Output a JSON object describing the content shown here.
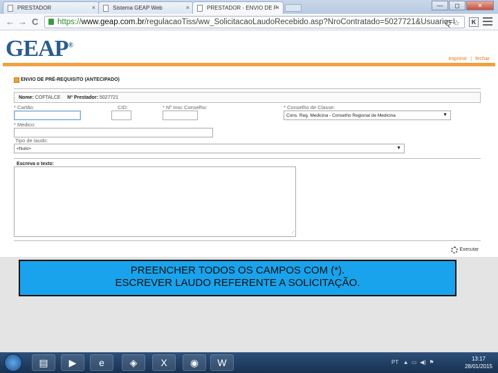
{
  "browser": {
    "tabs": [
      {
        "label": "PRESTADOR",
        "close": "×"
      },
      {
        "label": "Sistema GEAP Web",
        "close": "×"
      },
      {
        "label": "PRESTADOR - ENVIO DE P",
        "close": "×"
      }
    ],
    "window_controls": {
      "minimize": "—",
      "maximize": "◻",
      "close": "✕"
    },
    "nav": {
      "back": "←",
      "forward": "→",
      "reload": "C"
    },
    "url": {
      "scheme": "https://",
      "host": "www.geap.com.br",
      "path": "/regulacaoTiss/ww_SolicitacaoLaudoRecebido.asp?NroContratado=5027721&Usuario=I"
    },
    "url_icons": "Q ☆",
    "ext_button": "K"
  },
  "header": {
    "logo": "GEAP",
    "logo_mark": "®",
    "links": {
      "print": "imprimir",
      "separator": "|",
      "close": "fechar"
    }
  },
  "form": {
    "title": "ENVIO DE PRÉ-REQUISITO (ANTECIPADO)",
    "info": {
      "name_label": "Nome:",
      "name_value": "COFTALCE",
      "provider_label": "Nº Prestador:",
      "provider_value": "5027721"
    },
    "fields": {
      "cartao_label": "* Cartão:",
      "cid_label": "CID:",
      "conselho_num_label": "* Nº Insc Conselho:",
      "conselho_classe_label": "* Conselho de Classe:",
      "conselho_classe_value": "Cons. Reg. Medicina - Conselho Regional de Medicina",
      "medico_label": "* Medico:",
      "tipo_laudo_label": "Tipo de laudo:",
      "tipo_laudo_value": "<Nulo>",
      "texto_label": "Escreva o texto:"
    },
    "execute_label": "Executar"
  },
  "annotation": {
    "line1": "PREENCHER TODOS OS CAMPOS COM  (*).",
    "line2": "ESCREVER LAUDO REFERENTE A SOLICITAÇÃO."
  },
  "taskbar": {
    "lang": "PT",
    "time": "13:17",
    "date": "28/01/2015"
  }
}
